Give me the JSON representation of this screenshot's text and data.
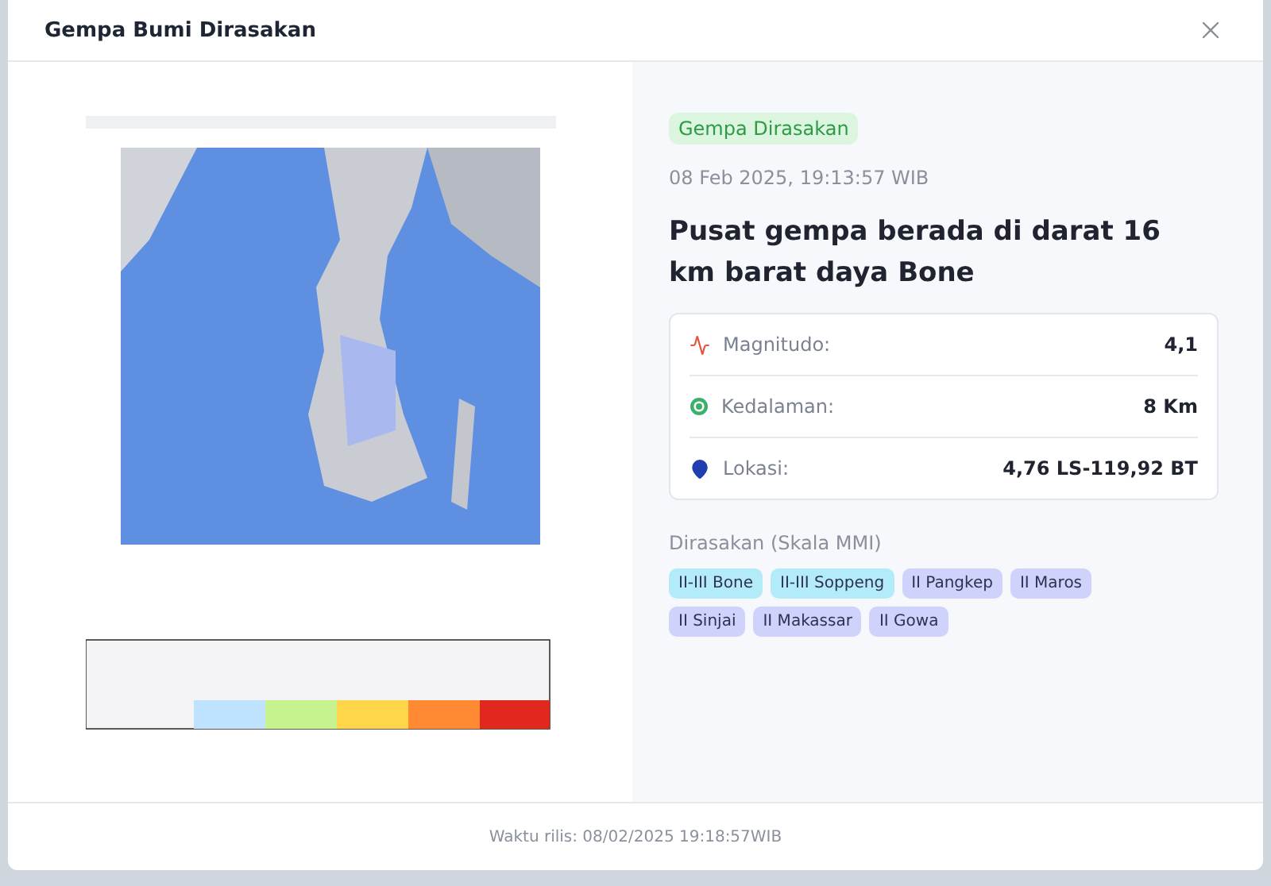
{
  "modal": {
    "title": "Gempa Bumi Dirasakan"
  },
  "badge": "Gempa Dirasakan",
  "datetime": "08 Feb 2025, 19:13:57 WIB",
  "headline": "Pusat gempa berada di darat 16 km barat daya Bone",
  "details": [
    {
      "kind": "magnitude",
      "label": "Magnitudo:",
      "value": "4,1"
    },
    {
      "kind": "depth",
      "label": "Kedalaman:",
      "value": "8 Km"
    },
    {
      "kind": "location",
      "label": "Lokasi:",
      "value": "4,76 LS-119,92 BT"
    }
  ],
  "felt_title": "Dirasakan (Skala MMI)",
  "felt": [
    {
      "label": "II-III Bone",
      "color": "#b3ecf8"
    },
    {
      "label": "II-III Soppeng",
      "color": "#b3ecf8"
    },
    {
      "label": "II Pangkep",
      "color": "#cfd2fb"
    },
    {
      "label": "II Maros",
      "color": "#cfd2fb"
    },
    {
      "label": "II Sinjai",
      "color": "#cfd2fb"
    },
    {
      "label": "II Makassar",
      "color": "#cfd2fb"
    },
    {
      "label": "II Gowa",
      "color": "#cfd2fb"
    }
  ],
  "footer": "Waktu rilis: 08/02/2025 19:18:57WIB"
}
